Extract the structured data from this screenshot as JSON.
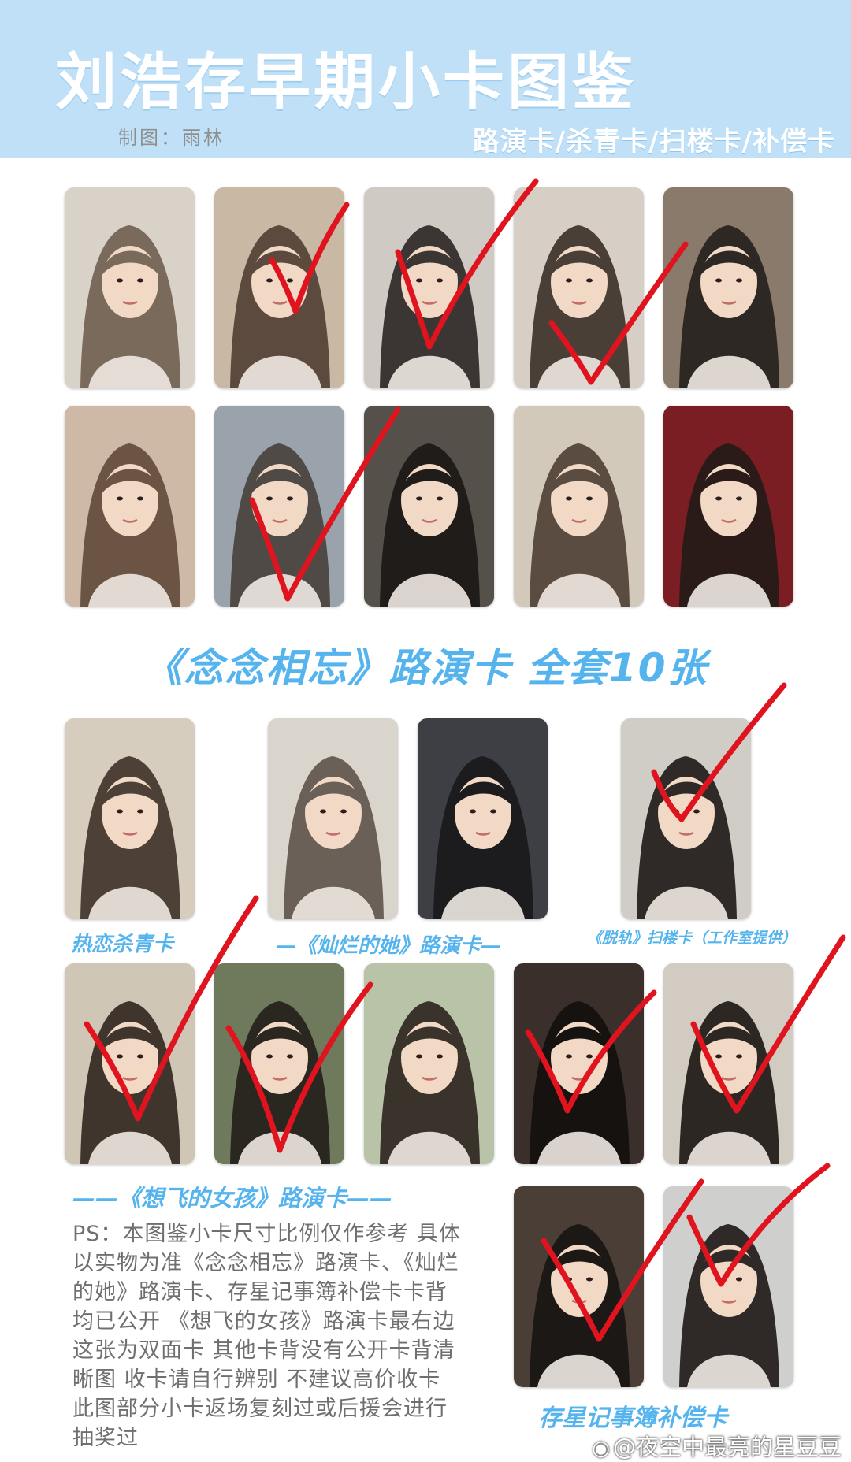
{
  "header": {
    "title": "刘浩存早期小卡图鉴",
    "credit": "制图：雨林",
    "subtitle": "路演卡/杀青卡/扫楼卡/补偿卡"
  },
  "sections": {
    "nian_nian": "《念念相忘》路演卡   全套10张",
    "re_lian": "热恋杀青卡",
    "can_lan": "—《灿烂的她》路演卡—",
    "tuo_gui": "《脱轨》扫楼卡（工作室提供）",
    "xiang_fei": "——《想飞的女孩》路演卡——",
    "cun_xing": "存星记事簿补偿卡"
  },
  "ps_note": "PS：本图鉴小卡尺寸比例仅作参考 具体以实物为准《念念相忘》路演卡、《灿烂的她》路演卡、存星记事簿补偿卡卡背均已公开 《想飞的女孩》路演卡最右边这张为双面卡 其他卡背没有公开卡背清晰图 收卡请自行辨别 不建议高价收卡 此图部分小卡返场复刻过或后援会进行抽奖过",
  "watermark": "@夜空中最亮的星豆豆",
  "icons": {
    "watermark_icon": "weibo-icon"
  },
  "colors": {
    "header_band": "#bfe0f7",
    "accent_blue": "#55b4ee",
    "check_red": "#e0141e"
  }
}
